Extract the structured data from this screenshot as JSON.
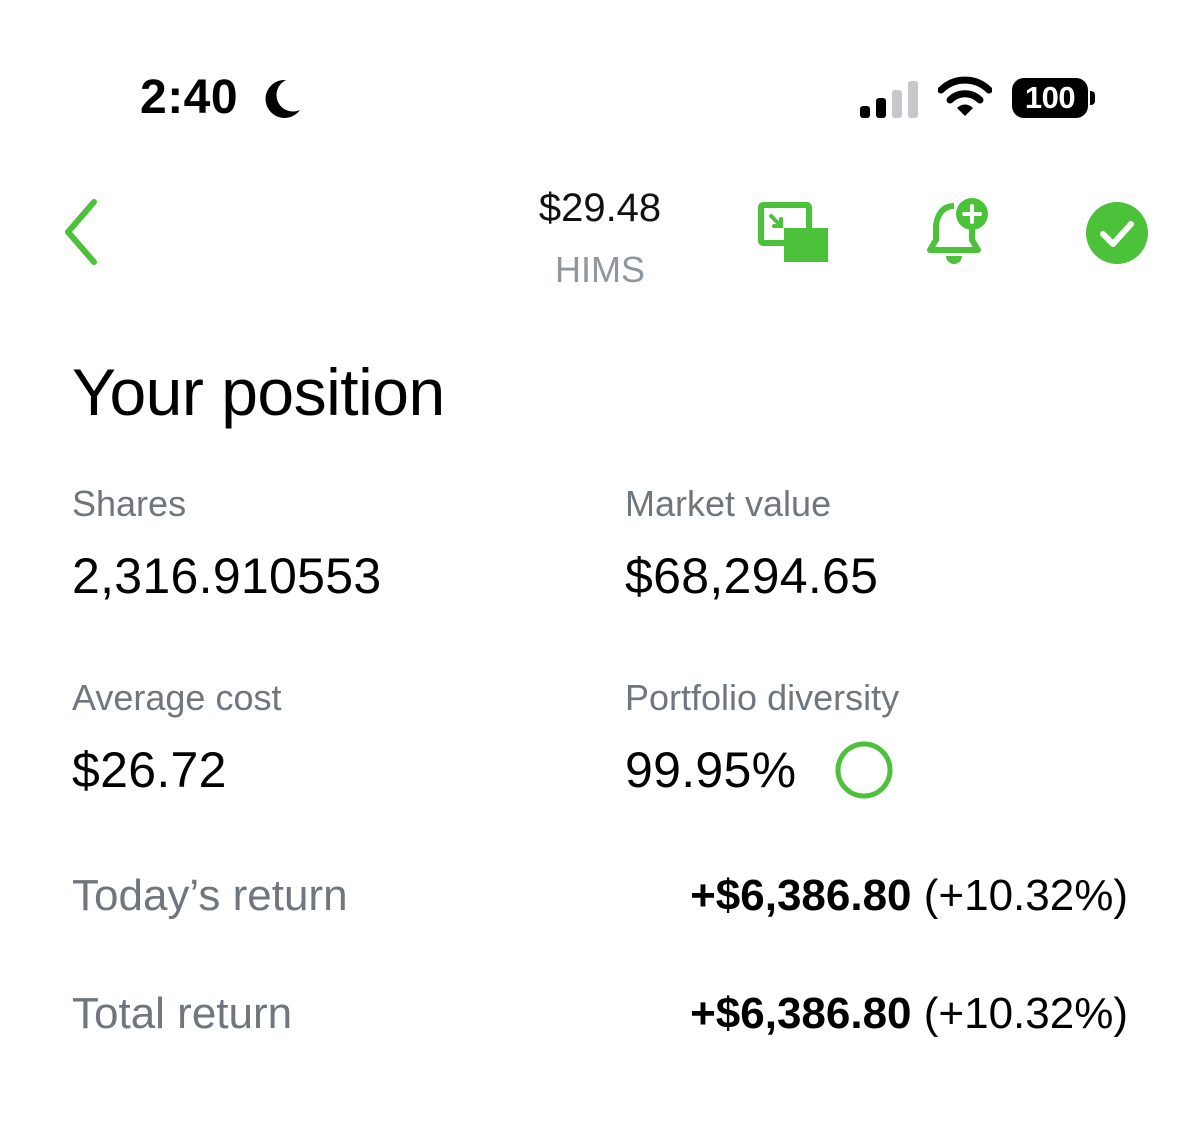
{
  "status_bar": {
    "time": "2:40",
    "battery": "100"
  },
  "header": {
    "price": "$29.48",
    "ticker": "HIMS"
  },
  "position": {
    "title": "Your position",
    "shares_label": "Shares",
    "shares_value": "2,316.910553",
    "market_value_label": "Market value",
    "market_value": "$68,294.65",
    "average_cost_label": "Average cost",
    "average_cost": "$26.72",
    "diversity_label": "Portfolio diversity",
    "diversity_value": "99.95%",
    "diversity_fraction": 0.9995
  },
  "returns": {
    "today_label": "Today’s return",
    "today_amount": "+$6,386.80",
    "today_percent": " (+10.32%)",
    "total_label": "Total return",
    "total_amount": "+$6,386.80",
    "total_percent": " (+10.32%)"
  },
  "colors": {
    "accent": "#4cc13a",
    "label_gray": "#6f767d",
    "ticker_gray": "#8f969d"
  },
  "icons": {
    "status": [
      "moon-icon",
      "cellular-signal-icon",
      "wifi-icon",
      "battery-icon"
    ],
    "nav": [
      "chevron-left-icon",
      "picture-in-picture-icon",
      "bell-plus-icon",
      "check-circle-icon"
    ]
  }
}
